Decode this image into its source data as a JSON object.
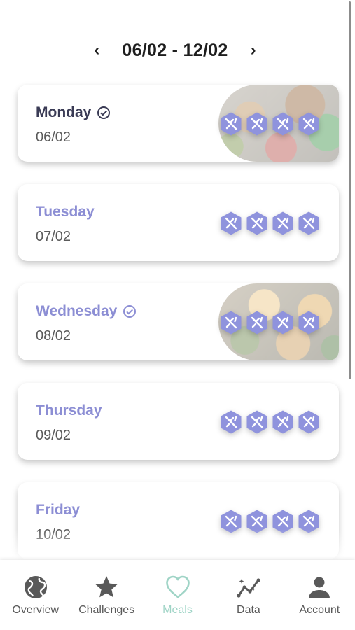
{
  "week": {
    "prev": "‹",
    "range": "06/02 - 12/02",
    "next": "›"
  },
  "days": [
    {
      "name": "Monday",
      "date": "06/02",
      "completed": true,
      "active": true,
      "has_photo": true,
      "photo": "food1"
    },
    {
      "name": "Tuesday",
      "date": "07/02",
      "completed": false,
      "active": false,
      "has_photo": false
    },
    {
      "name": "Wednesday",
      "date": "08/02",
      "completed": true,
      "active": false,
      "has_photo": true,
      "photo": "food2"
    },
    {
      "name": "Thursday",
      "date": "09/02",
      "completed": false,
      "active": false,
      "has_photo": false
    },
    {
      "name": "Friday",
      "date": "10/02",
      "completed": false,
      "active": false,
      "has_photo": false
    }
  ],
  "meal_icon_count": 4,
  "nav": [
    {
      "label": "Overview",
      "icon": "globe-icon"
    },
    {
      "label": "Challenges",
      "icon": "star-icon"
    },
    {
      "label": "Meals",
      "icon": "heart-icon",
      "active": true
    },
    {
      "label": "Data",
      "icon": "chart-icon"
    },
    {
      "label": "Account",
      "icon": "person-icon"
    }
  ],
  "colors": {
    "accent": "#8c8ed4",
    "active_nav": "#9fd4c6",
    "active_day": "#3a3b55",
    "meal_hex": "#8f93dd"
  }
}
